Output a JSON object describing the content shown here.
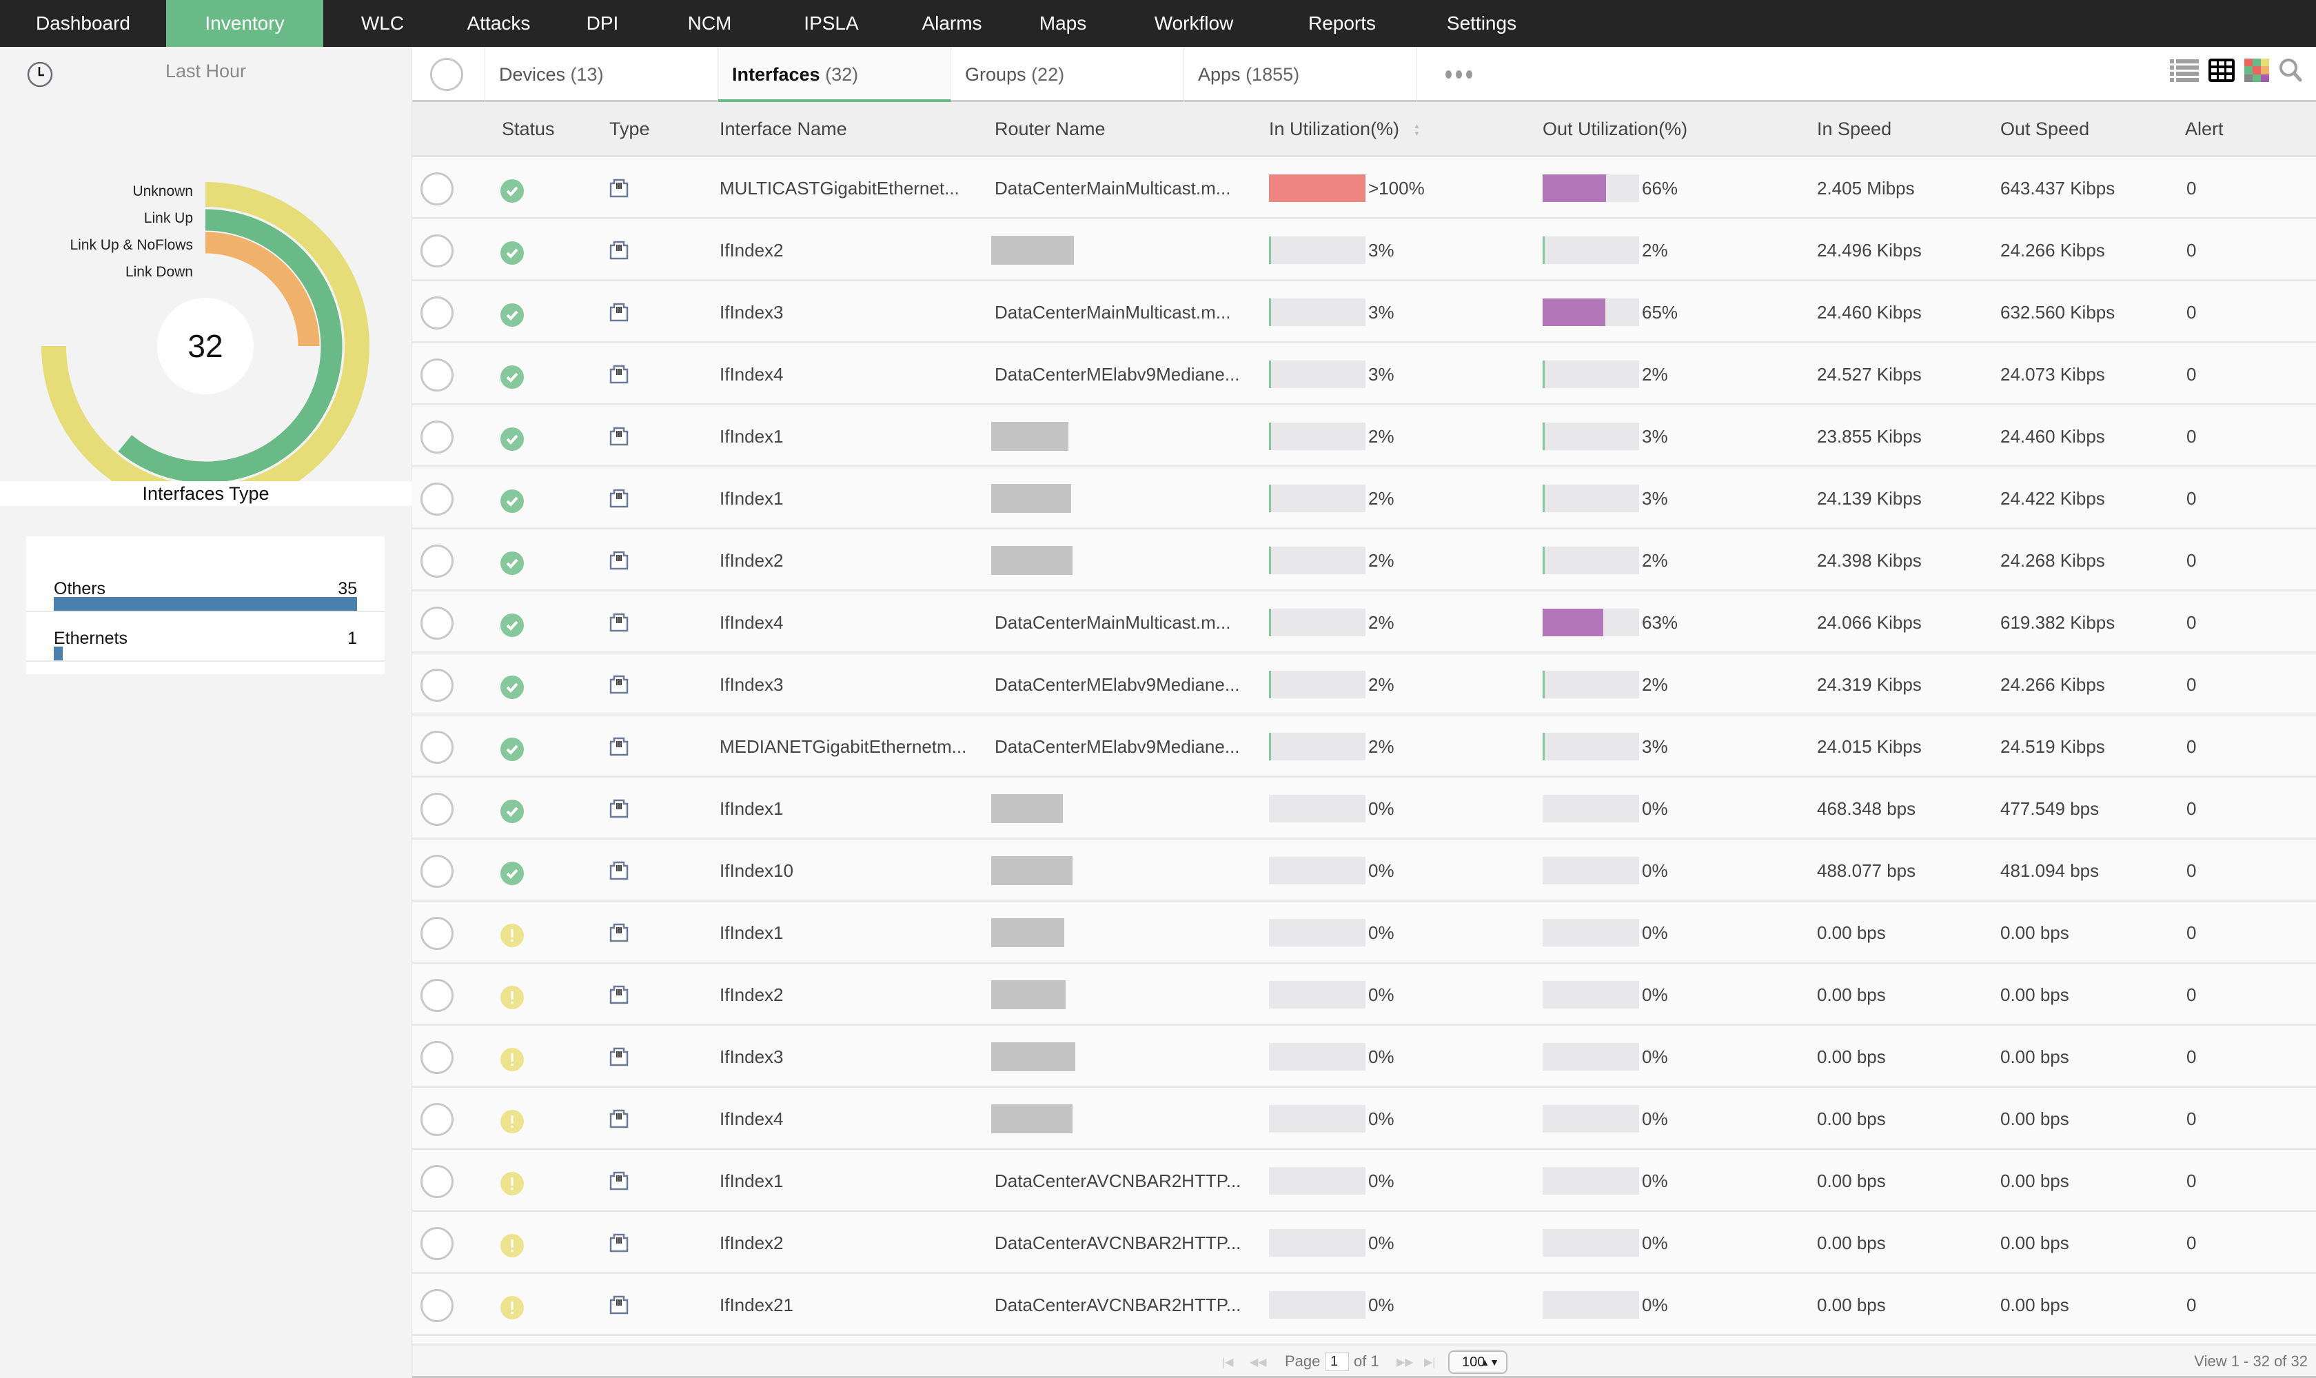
{
  "nav": {
    "items": [
      {
        "label": "Dashboard",
        "active": false
      },
      {
        "label": "Inventory",
        "active": true
      },
      {
        "label": "WLC",
        "active": false
      },
      {
        "label": "Attacks",
        "active": false
      },
      {
        "label": "DPI",
        "active": false
      },
      {
        "label": "NCM",
        "active": false
      },
      {
        "label": "IPSLA",
        "active": false
      },
      {
        "label": "Alarms",
        "active": false
      },
      {
        "label": "Maps",
        "active": false
      },
      {
        "label": "Workflow",
        "active": false
      },
      {
        "label": "Reports",
        "active": false
      },
      {
        "label": "Settings",
        "active": false
      }
    ]
  },
  "sidebar": {
    "time_range": "Last Hour",
    "total": "32",
    "status_rings": [
      {
        "label": "Unknown",
        "fraction_of_circle": 0.75,
        "color": "#e6dd78"
      },
      {
        "label": "Link Up",
        "fraction_of_circle": 0.61,
        "color": "#6aba87"
      },
      {
        "label": "Link Up & NoFlows",
        "fraction_of_circle": 0.25,
        "color": "#f0b26b"
      },
      {
        "label": "Link Down",
        "fraction_of_circle": 0,
        "color": "#e8685f"
      }
    ],
    "types_title": "Interfaces Type",
    "types": [
      {
        "label": "Others",
        "value": "35",
        "fraction": 1.0
      },
      {
        "label": "Ethernets",
        "value": "1",
        "fraction": 0.029
      }
    ]
  },
  "tabs": [
    {
      "label": "Devices",
      "count": "(13)",
      "active": false
    },
    {
      "label": "Interfaces",
      "count": "(32)",
      "active": true
    },
    {
      "label": "Groups",
      "count": "(22)",
      "active": false
    },
    {
      "label": "Apps",
      "count": "(1855)",
      "active": false
    }
  ],
  "view_icons": [
    "list-view-icon",
    "grid-view-icon",
    "heatmap-view-icon",
    "search-icon"
  ],
  "columns": [
    "Status",
    "Type",
    "Interface Name",
    "Router Name",
    "In Utilization(%)",
    "Out Utilization(%)",
    "In Speed",
    "Out Speed",
    "Alert"
  ],
  "colors": {
    "accent": "#6aba87",
    "in_util_high": "#ee8580",
    "out_util_high": "#b376b8",
    "util_low": "#86c79b",
    "status_ok": "#86c79b",
    "status_warn": "#ede28e",
    "type_bar": "#4a7fae"
  },
  "rows": [
    {
      "status": "ok",
      "name": "MULTICASTGigabitEthernet...",
      "router": "DataCenterMainMulticast.m...",
      "in_util": ">100%",
      "in_val": 100,
      "out_util": "66%",
      "out_val": 66,
      "in_speed": "2.405 Mibps",
      "out_speed": "643.437 Kibps",
      "alert": "0"
    },
    {
      "status": "ok",
      "name": "IfIndex2",
      "router": "",
      "in_util": "3%",
      "in_val": 3,
      "out_util": "2%",
      "out_val": 2,
      "in_speed": "24.496 Kibps",
      "out_speed": "24.266 Kibps",
      "alert": "0"
    },
    {
      "status": "ok",
      "name": "IfIndex3",
      "router": "DataCenterMainMulticast.m...",
      "in_util": "3%",
      "in_val": 3,
      "out_util": "65%",
      "out_val": 65,
      "in_speed": "24.460 Kibps",
      "out_speed": "632.560 Kibps",
      "alert": "0"
    },
    {
      "status": "ok",
      "name": "IfIndex4",
      "router": "DataCenterMElabv9Mediane...",
      "in_util": "3%",
      "in_val": 3,
      "out_util": "2%",
      "out_val": 2,
      "in_speed": "24.527 Kibps",
      "out_speed": "24.073 Kibps",
      "alert": "0"
    },
    {
      "status": "ok",
      "name": "IfIndex1",
      "router": "",
      "in_util": "2%",
      "in_val": 2,
      "out_util": "3%",
      "out_val": 3,
      "in_speed": "23.855 Kibps",
      "out_speed": "24.460 Kibps",
      "alert": "0"
    },
    {
      "status": "ok",
      "name": "IfIndex1",
      "router": "",
      "in_util": "2%",
      "in_val": 2,
      "out_util": "3%",
      "out_val": 3,
      "in_speed": "24.139 Kibps",
      "out_speed": "24.422 Kibps",
      "alert": "0"
    },
    {
      "status": "ok",
      "name": "IfIndex2",
      "router": "",
      "in_util": "2%",
      "in_val": 2,
      "out_util": "2%",
      "out_val": 2,
      "in_speed": "24.398 Kibps",
      "out_speed": "24.268 Kibps",
      "alert": "0"
    },
    {
      "status": "ok",
      "name": "IfIndex4",
      "router": "DataCenterMainMulticast.m...",
      "in_util": "2%",
      "in_val": 2,
      "out_util": "63%",
      "out_val": 63,
      "in_speed": "24.066 Kibps",
      "out_speed": "619.382 Kibps",
      "alert": "0"
    },
    {
      "status": "ok",
      "name": "IfIndex3",
      "router": "DataCenterMElabv9Mediane...",
      "in_util": "2%",
      "in_val": 2,
      "out_util": "2%",
      "out_val": 2,
      "in_speed": "24.319 Kibps",
      "out_speed": "24.266 Kibps",
      "alert": "0"
    },
    {
      "status": "ok",
      "name": "MEDIANETGigabitEthernetm...",
      "router": "DataCenterMElabv9Mediane...",
      "in_util": "2%",
      "in_val": 2,
      "out_util": "3%",
      "out_val": 3,
      "in_speed": "24.015 Kibps",
      "out_speed": "24.519 Kibps",
      "alert": "0"
    },
    {
      "status": "ok",
      "name": "IfIndex1",
      "router": "",
      "in_util": "0%",
      "in_val": 0,
      "out_util": "0%",
      "out_val": 0,
      "in_speed": "468.348 bps",
      "out_speed": "477.549 bps",
      "alert": "0"
    },
    {
      "status": "ok",
      "name": "IfIndex10",
      "router": "",
      "in_util": "0%",
      "in_val": 0,
      "out_util": "0%",
      "out_val": 0,
      "in_speed": "488.077 bps",
      "out_speed": "481.094 bps",
      "alert": "0"
    },
    {
      "status": "warn",
      "name": "IfIndex1",
      "router": "",
      "in_util": "0%",
      "in_val": 0,
      "out_util": "0%",
      "out_val": 0,
      "in_speed": "0.00 bps",
      "out_speed": "0.00 bps",
      "alert": "0"
    },
    {
      "status": "warn",
      "name": "IfIndex2",
      "router": "",
      "in_util": "0%",
      "in_val": 0,
      "out_util": "0%",
      "out_val": 0,
      "in_speed": "0.00 bps",
      "out_speed": "0.00 bps",
      "alert": "0"
    },
    {
      "status": "warn",
      "name": "IfIndex3",
      "router": "",
      "in_util": "0%",
      "in_val": 0,
      "out_util": "0%",
      "out_val": 0,
      "in_speed": "0.00 bps",
      "out_speed": "0.00 bps",
      "alert": "0"
    },
    {
      "status": "warn",
      "name": "IfIndex4",
      "router": "",
      "in_util": "0%",
      "in_val": 0,
      "out_util": "0%",
      "out_val": 0,
      "in_speed": "0.00 bps",
      "out_speed": "0.00 bps",
      "alert": "0"
    },
    {
      "status": "warn",
      "name": "IfIndex1",
      "router": "DataCenterAVCNBAR2HTTP...",
      "in_util": "0%",
      "in_val": 0,
      "out_util": "0%",
      "out_val": 0,
      "in_speed": "0.00 bps",
      "out_speed": "0.00 bps",
      "alert": "0"
    },
    {
      "status": "warn",
      "name": "IfIndex2",
      "router": "DataCenterAVCNBAR2HTTP...",
      "in_util": "0%",
      "in_val": 0,
      "out_util": "0%",
      "out_val": 0,
      "in_speed": "0.00 bps",
      "out_speed": "0.00 bps",
      "alert": "0"
    },
    {
      "status": "warn",
      "name": "IfIndex21",
      "router": "DataCenterAVCNBAR2HTTP...",
      "in_util": "0%",
      "in_val": 0,
      "out_util": "0%",
      "out_val": 0,
      "in_speed": "0.00 bps",
      "out_speed": "0.00 bps",
      "alert": "0"
    }
  ],
  "pager": {
    "page_label": "Page",
    "page_value": "1",
    "of_label": "of 1",
    "page_size": "100",
    "view_summary": "View 1 - 32 of 32"
  }
}
